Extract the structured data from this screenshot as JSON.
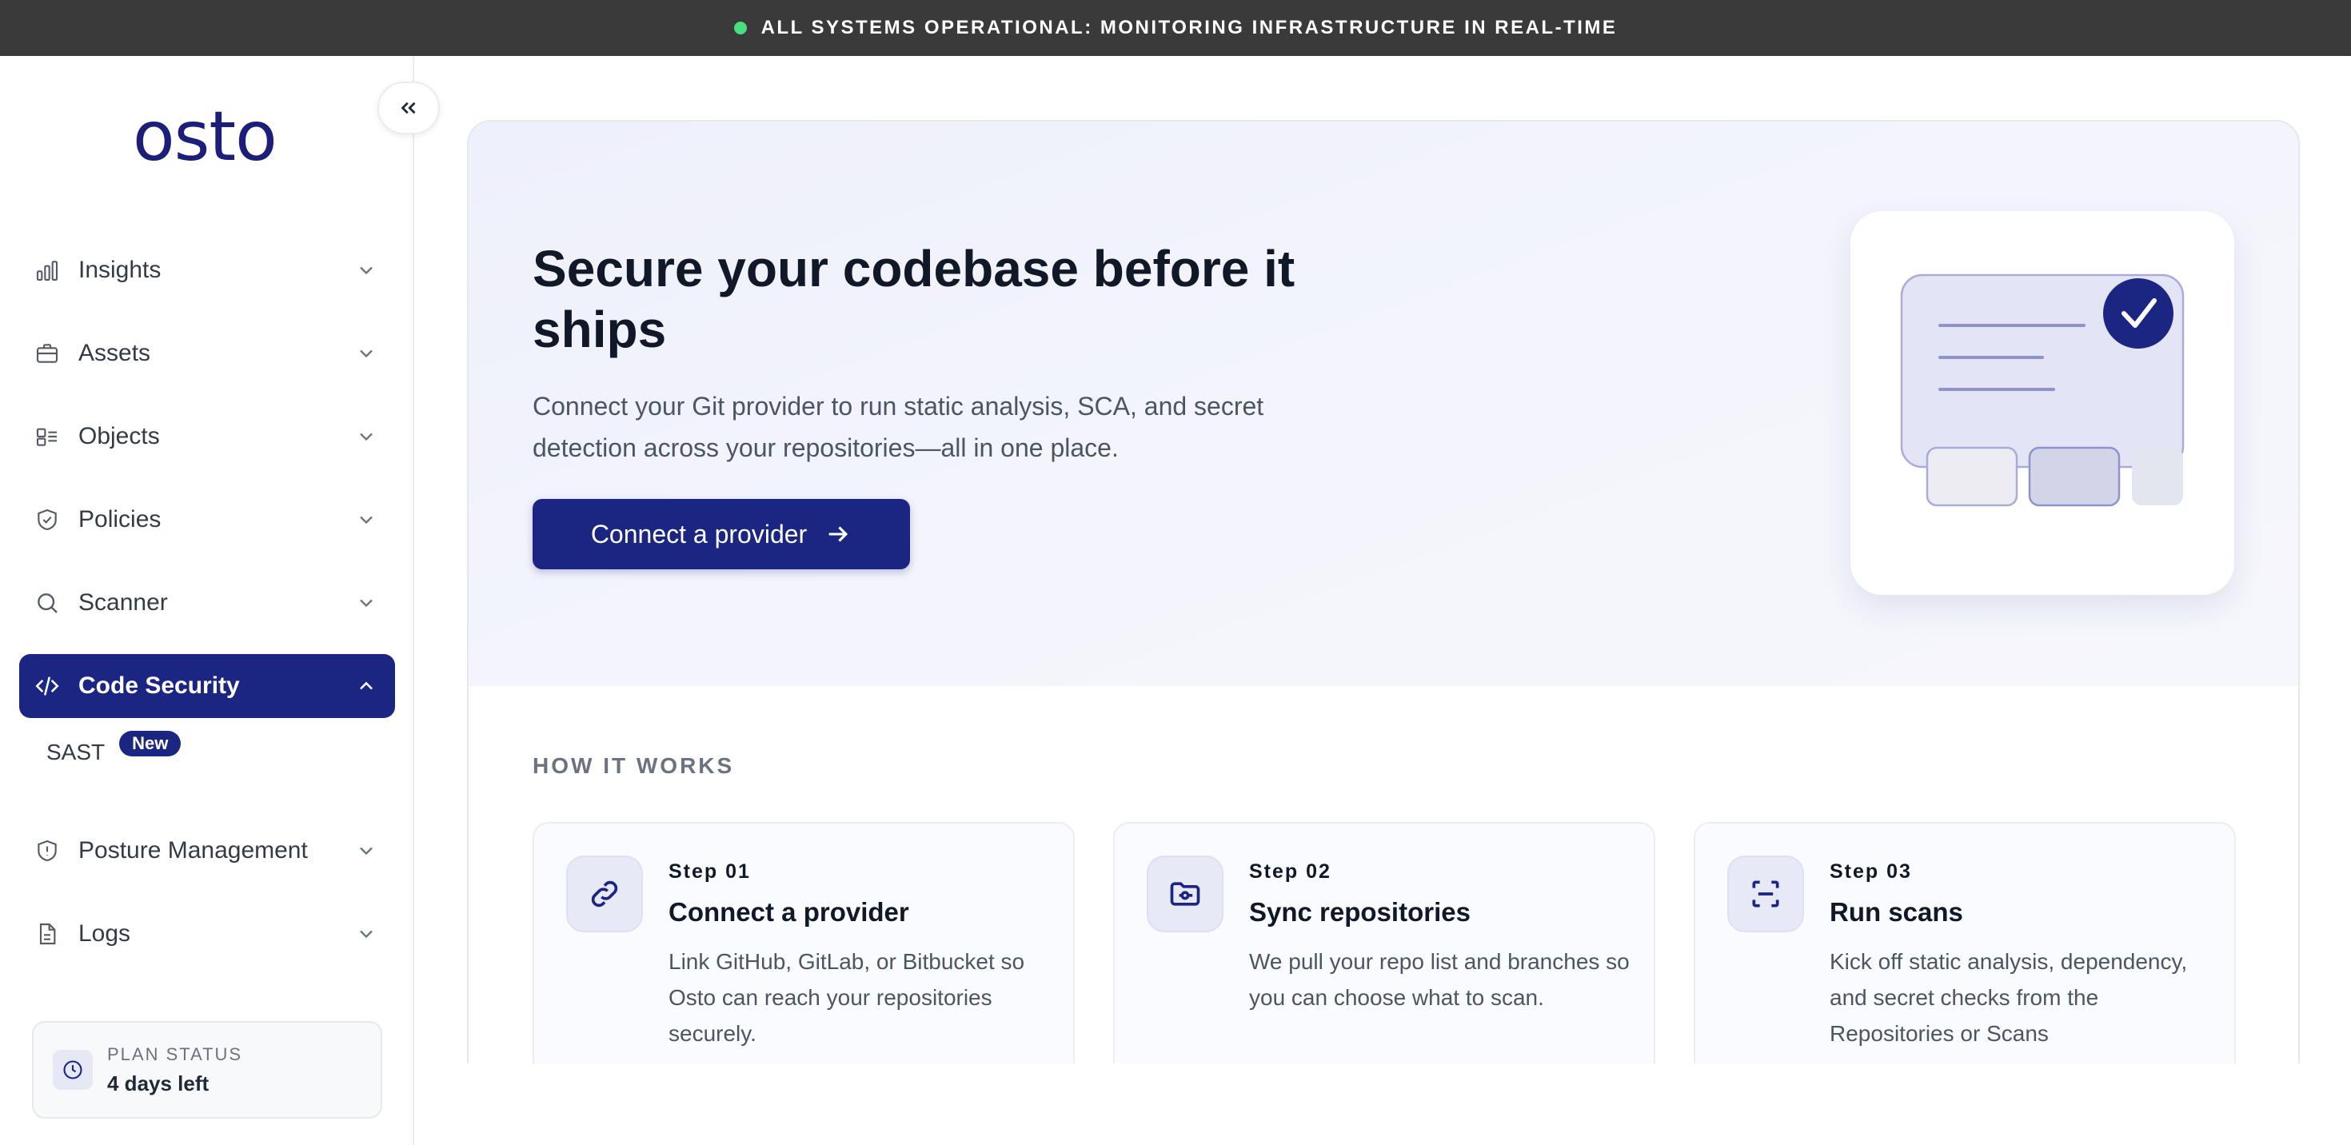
{
  "banner": {
    "text": "ALL SYSTEMS OPERATIONAL: MONITORING INFRASTRUCTURE IN REAL-TIME",
    "status_color": "#4ade80"
  },
  "sidebar": {
    "logo": "osto",
    "items": [
      {
        "label": "Insights",
        "icon": "bar-chart-icon"
      },
      {
        "label": "Assets",
        "icon": "briefcase-icon"
      },
      {
        "label": "Objects",
        "icon": "objects-icon"
      },
      {
        "label": "Policies",
        "icon": "shield-check-icon"
      },
      {
        "label": "Scanner",
        "icon": "search-icon"
      },
      {
        "label": "Code Security",
        "icon": "code-icon",
        "active": true
      },
      {
        "label": "Posture Management",
        "icon": "shield-alert-icon"
      },
      {
        "label": "Logs",
        "icon": "file-icon"
      }
    ],
    "sub_items": [
      {
        "label": "SAST",
        "badge": "New"
      }
    ],
    "plan": {
      "title": "PLAN STATUS",
      "value": "4 days left"
    }
  },
  "hero": {
    "title": "Secure your codebase before it ships",
    "description": "Connect your Git provider to run static analysis, SCA, and secret detection across your repositories—all in one place.",
    "cta_label": "Connect a provider"
  },
  "how_it_works": {
    "heading": "HOW IT WORKS",
    "steps": [
      {
        "number": "Step 01",
        "title": "Connect a provider",
        "description": "Link GitHub, GitLab, or Bitbucket so Osto can reach your repositories securely.",
        "icon": "link-icon"
      },
      {
        "number": "Step 02",
        "title": "Sync repositories",
        "description": "We pull your repo list and branches so you can choose what to scan.",
        "icon": "folder-icon"
      },
      {
        "number": "Step 03",
        "title": "Run scans",
        "description": "Kick off static analysis, dependency, and secret checks from the Repositories or Scans",
        "icon": "scan-icon"
      }
    ]
  },
  "colors": {
    "brand": "#1b2582",
    "hero_bg": "#eef0fb"
  }
}
